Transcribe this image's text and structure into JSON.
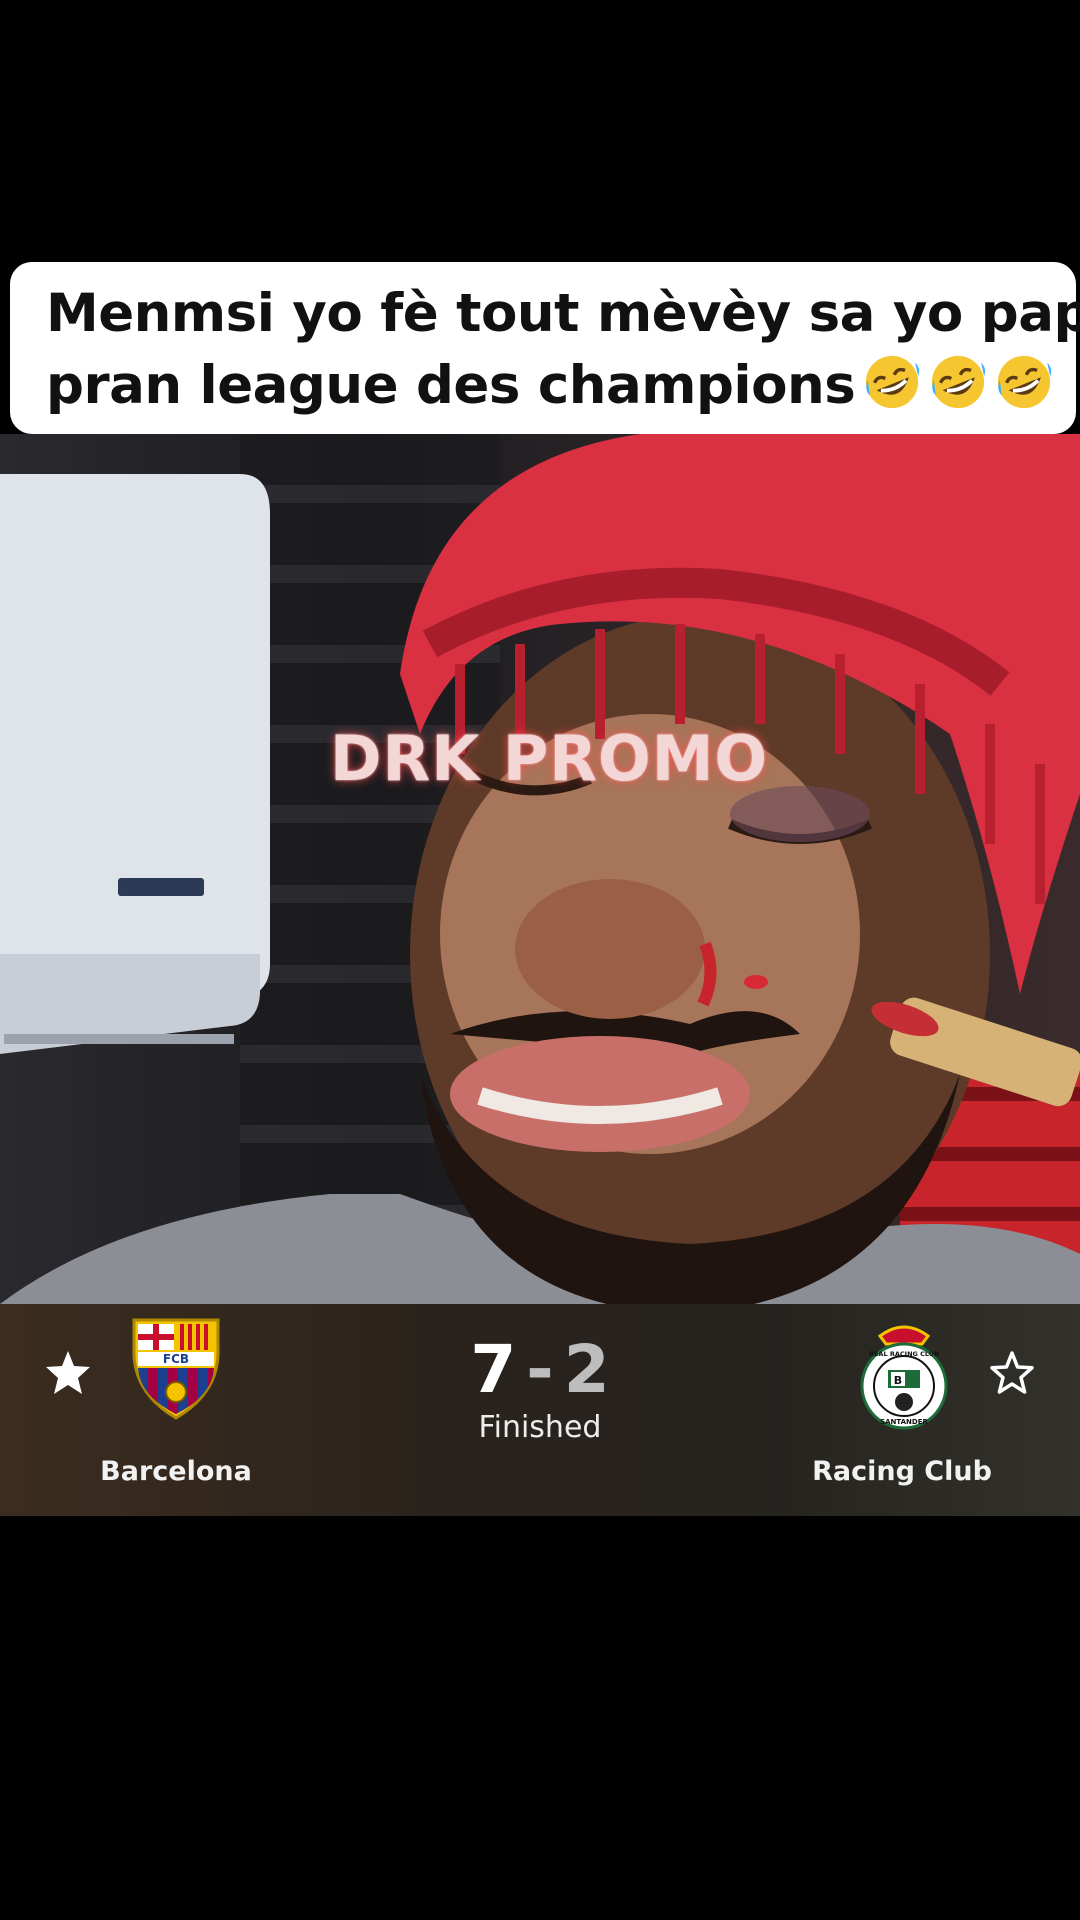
{
  "caption": {
    "line1": "Menmsi yo fè tout mèvèy sa yo pap",
    "line2": "pran league des champions",
    "emoji_icon": "rolling-on-floor-laughing-emoji",
    "emoji_count": 3
  },
  "video": {
    "watermark": "DRK PROMO"
  },
  "match": {
    "home_team": "Barcelona",
    "home_crest_text": "FCB",
    "home_score": "7",
    "separator": "-",
    "away_score": "2",
    "away_team": "Racing Club",
    "away_crest_top_text": "REAL RACING CLUB",
    "away_crest_bottom_text": "SANTANDER",
    "status": "Finished",
    "home_favorite": true,
    "away_favorite": false,
    "colors": {
      "barca_blue": "#1d3f8f",
      "barca_garnet": "#a50044",
      "barca_yellow": "#f5c400",
      "racing_green": "#1e6b3a"
    }
  }
}
